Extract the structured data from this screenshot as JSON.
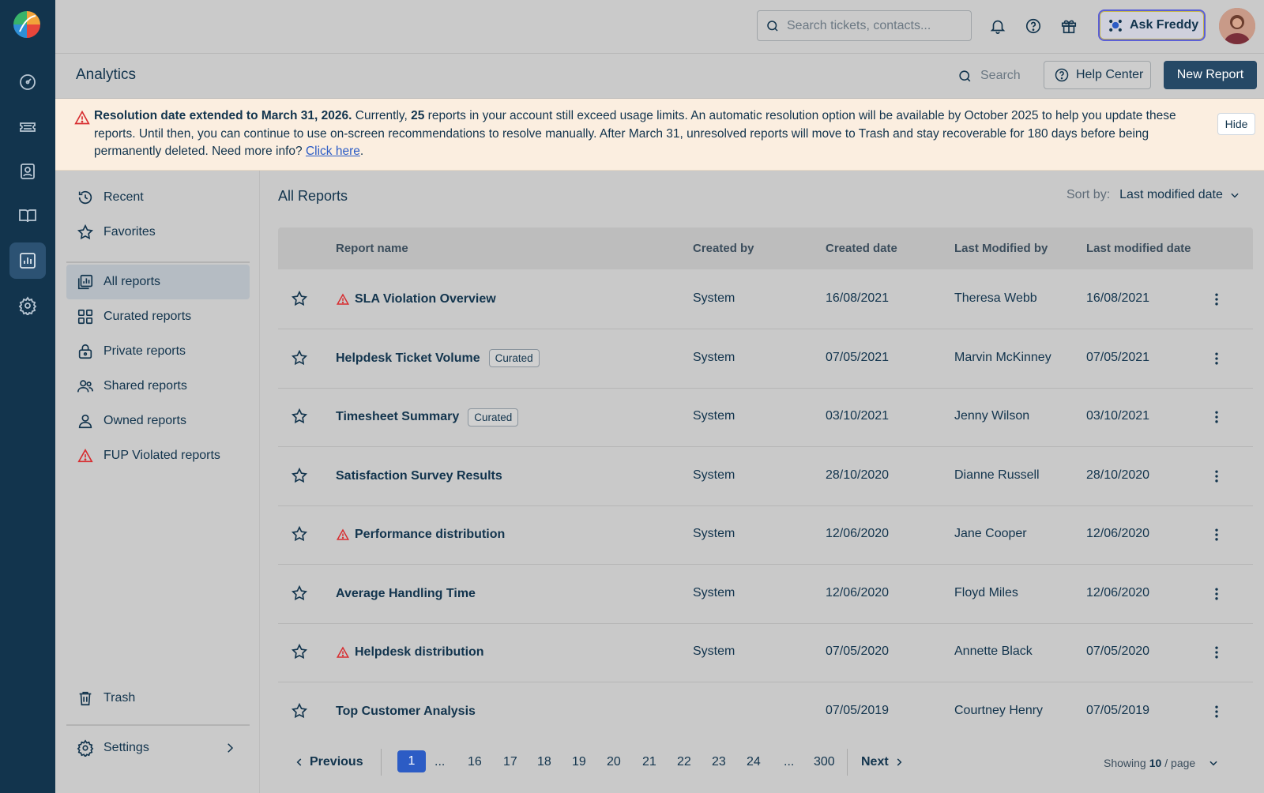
{
  "topbar": {
    "search_placeholder": "Search tickets, contacts...",
    "ask_freddy": "Ask Freddy"
  },
  "rail": {
    "items": [
      "dashboard-icon",
      "tickets-icon",
      "contacts-icon",
      "knowledge-base-icon",
      "analytics-icon",
      "admin-settings-icon"
    ],
    "active": "analytics-icon"
  },
  "page": {
    "title": "Analytics",
    "search_label": "Search",
    "help_center": "Help Center",
    "new_report": "New Report"
  },
  "banner": {
    "bold": "Resolution date extended to March 31, 2026.",
    "part1": " Currently, ",
    "count": "25",
    "part2": " reports in your account still exceed usage limits. An automatic resolution option will be available by October 2025 to help you update these reports. Until then, you can continue to use on-screen recommendations to resolve manually. After March 31, unresolved reports will move to Trash and stay recoverable for 180 days before being permanently deleted. Need more info? ",
    "link": "Click here",
    "end": ".",
    "hide": "Hide"
  },
  "sidebar": {
    "recent": "Recent",
    "favorites": "Favorites",
    "all_reports": "All reports",
    "curated": "Curated reports",
    "private": "Private reports",
    "shared": "Shared reports",
    "owned": "Owned reports",
    "fup": "FUP Violated reports",
    "trash": "Trash",
    "settings": "Settings"
  },
  "main": {
    "title": "All Reports",
    "sort_label": "Sort by:",
    "sort_value": "Last modified date",
    "columns": {
      "name": "Report name",
      "created_by": "Created by",
      "created_date": "Created date",
      "modified_by": "Last Modified by",
      "modified_date": "Last modified date"
    },
    "rows": [
      {
        "name": "SLA Violation Overview",
        "warning": true,
        "badge": "",
        "created_by": "System",
        "created_date": "16/08/2021",
        "modified_by": "Theresa Webb",
        "modified_date": "16/08/2021"
      },
      {
        "name": "Helpdesk Ticket Volume",
        "warning": false,
        "badge": "Curated",
        "created_by": "System",
        "created_date": "07/05/2021",
        "modified_by": "Marvin McKinney",
        "modified_date": "07/05/2021"
      },
      {
        "name": "Timesheet Summary",
        "warning": false,
        "badge": "Curated",
        "created_by": "System",
        "created_date": "03/10/2021",
        "modified_by": "Jenny Wilson",
        "modified_date": "03/10/2021"
      },
      {
        "name": "Satisfaction Survey Results",
        "warning": false,
        "badge": "",
        "created_by": "System",
        "created_date": "28/10/2020",
        "modified_by": "Dianne Russell",
        "modified_date": "28/10/2020"
      },
      {
        "name": "Performance distribution",
        "warning": true,
        "badge": "",
        "created_by": "System",
        "created_date": "12/06/2020",
        "modified_by": "Jane Cooper",
        "modified_date": "12/06/2020"
      },
      {
        "name": "Average Handling Time",
        "warning": false,
        "badge": "",
        "created_by": "System",
        "created_date": "12/06/2020",
        "modified_by": "Floyd Miles",
        "modified_date": "12/06/2020"
      },
      {
        "name": "Helpdesk distribution",
        "warning": true,
        "badge": "",
        "created_by": "System",
        "created_date": "07/05/2020",
        "modified_by": "Annette Black",
        "modified_date": "07/05/2020"
      },
      {
        "name": "Top Customer Analysis",
        "warning": false,
        "badge": "",
        "created_by": "",
        "created_date": "07/05/2019",
        "modified_by": "Courtney Henry",
        "modified_date": "07/05/2019"
      }
    ]
  },
  "pagination": {
    "previous": "Previous",
    "next": "Next",
    "pages": [
      "1",
      "...",
      "16",
      "17",
      "18",
      "19",
      "20",
      "21",
      "22",
      "23",
      "24",
      "...",
      "300"
    ],
    "current": "1",
    "showing_prefix": "Showing",
    "showing_count": "10",
    "showing_suffix": "/ page"
  }
}
